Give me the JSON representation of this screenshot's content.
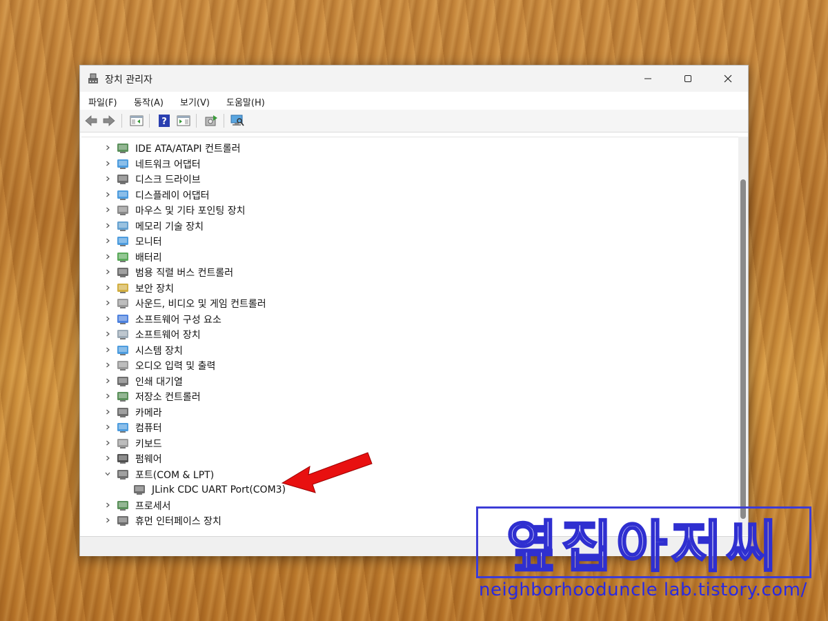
{
  "window": {
    "title": "장치 관리자",
    "controls": [
      "minimize",
      "maximize",
      "close"
    ]
  },
  "menu": [
    "파일(F)",
    "동작(A)",
    "보기(V)",
    "도움말(H)"
  ],
  "toolbar": [
    "back-icon",
    "forward-icon",
    "show-hide-tree-icon",
    "help-icon",
    "properties-icon",
    "update-driver-icon",
    "scan-hardware-icon"
  ],
  "tree": [
    {
      "label": "IDE ATA/ATAPI 컨트롤러",
      "expanded": false,
      "icon": "ide-controller-icon",
      "color": "#3d7d3d"
    },
    {
      "label": "네트워크 어댑터",
      "expanded": false,
      "icon": "network-adapter-icon",
      "color": "#2e8bd8"
    },
    {
      "label": "디스크 드라이브",
      "expanded": false,
      "icon": "disk-drive-icon",
      "color": "#555555"
    },
    {
      "label": "디스플레이 어댑터",
      "expanded": false,
      "icon": "display-adapter-icon",
      "color": "#2e8bd8"
    },
    {
      "label": "마우스 및 기타 포인팅 장치",
      "expanded": false,
      "icon": "mouse-icon",
      "color": "#777777"
    },
    {
      "label": "메모리 기술 장치",
      "expanded": false,
      "icon": "memory-device-icon",
      "color": "#4a90c8"
    },
    {
      "label": "모니터",
      "expanded": false,
      "icon": "monitor-icon",
      "color": "#2e8bd8"
    },
    {
      "label": "배터리",
      "expanded": false,
      "icon": "battery-icon",
      "color": "#3d9a3d"
    },
    {
      "label": "범용 직렬 버스 컨트롤러",
      "expanded": false,
      "icon": "usb-controller-icon",
      "color": "#555555"
    },
    {
      "label": "보안 장치",
      "expanded": false,
      "icon": "security-device-icon",
      "color": "#c9a020"
    },
    {
      "label": "사운드, 비디오 및 게임 컨트롤러",
      "expanded": false,
      "icon": "sound-icon",
      "color": "#888888"
    },
    {
      "label": "소프트웨어 구성 요소",
      "expanded": false,
      "icon": "software-component-icon",
      "color": "#2e6bd8"
    },
    {
      "label": "소프트웨어 장치",
      "expanded": false,
      "icon": "software-device-icon",
      "color": "#8a9aa8"
    },
    {
      "label": "시스템 장치",
      "expanded": false,
      "icon": "system-device-icon",
      "color": "#2e8bd8"
    },
    {
      "label": "오디오 입력 및 출력",
      "expanded": false,
      "icon": "audio-io-icon",
      "color": "#888888"
    },
    {
      "label": "인쇄 대기열",
      "expanded": false,
      "icon": "print-queue-icon",
      "color": "#555555"
    },
    {
      "label": "저장소 컨트롤러",
      "expanded": false,
      "icon": "storage-controller-icon",
      "color": "#3d7d3d"
    },
    {
      "label": "카메라",
      "expanded": false,
      "icon": "camera-icon",
      "color": "#555555"
    },
    {
      "label": "컴퓨터",
      "expanded": false,
      "icon": "computer-icon",
      "color": "#2e8bd8"
    },
    {
      "label": "키보드",
      "expanded": false,
      "icon": "keyboard-icon",
      "color": "#888888"
    },
    {
      "label": "펌웨어",
      "expanded": false,
      "icon": "firmware-icon",
      "color": "#333333"
    },
    {
      "label": "포트(COM & LPT)",
      "expanded": true,
      "icon": "port-icon",
      "color": "#555555"
    },
    {
      "label": "JLink CDC UART Port(COM3)",
      "child": true,
      "icon": "port-device-icon",
      "color": "#555555"
    },
    {
      "label": "프로세서",
      "expanded": false,
      "icon": "processor-icon",
      "color": "#3d7d3d"
    },
    {
      "label": "휴먼 인터페이스 장치",
      "expanded": false,
      "icon": "hid-icon",
      "color": "#555555"
    }
  ],
  "annotation": {
    "arrow_color": "#e81010"
  },
  "watermark": {
    "text": "옆집아저씨",
    "url": "neighborhooduncle lab.tistory.com/"
  }
}
